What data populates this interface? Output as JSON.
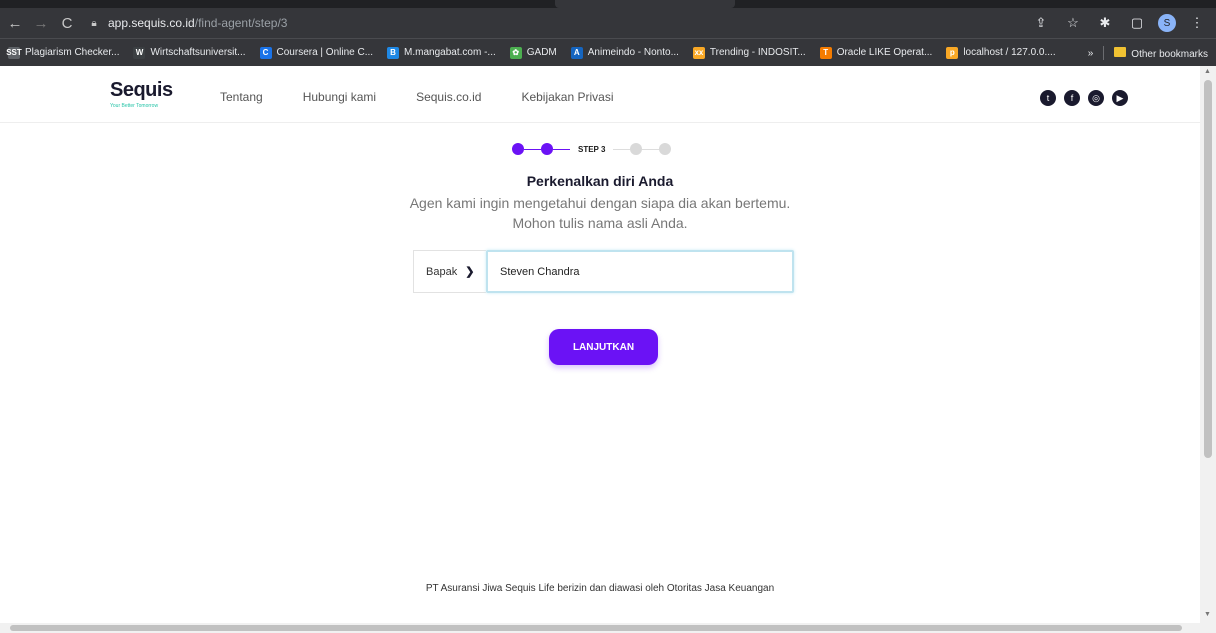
{
  "browser": {
    "url_host": "app.sequis.co.id",
    "url_path": "/find-agent/step/3",
    "profile_initial": "S",
    "bookmarks": [
      {
        "label": "Plagiarism Checker...",
        "icon": "checker-icon",
        "color": "#5f6368",
        "glyph": "SST"
      },
      {
        "label": "Wirtschaftsuniversit...",
        "icon": "w-icon",
        "color": "#3c4043",
        "glyph": "W"
      },
      {
        "label": "Coursera | Online C...",
        "icon": "coursera-icon",
        "color": "#1a73e8",
        "glyph": "C"
      },
      {
        "label": "M.mangabat.com -...",
        "icon": "mangabat-icon",
        "color": "#1e88e5",
        "glyph": "B"
      },
      {
        "label": "GADM",
        "icon": "gadm-icon",
        "color": "#4caf50",
        "glyph": "✿"
      },
      {
        "label": "Animeindo - Nonto...",
        "icon": "animeindo-icon",
        "color": "#1565c0",
        "glyph": "A"
      },
      {
        "label": "Trending - INDOSIT...",
        "icon": "indosit-icon",
        "color": "#f9a825",
        "glyph": "xx"
      },
      {
        "label": "Oracle LIKE Operat...",
        "icon": "oracle-icon",
        "color": "#f57c00",
        "glyph": "T"
      },
      {
        "label": "localhost / 127.0.0....",
        "icon": "phpmyadmin-icon",
        "color": "#f9a825",
        "glyph": "p"
      }
    ],
    "more_label": "»",
    "other_bookmarks": "Other bookmarks"
  },
  "header": {
    "brand": "Sequis",
    "tagline": "Your Better Tomorrow",
    "nav": [
      "Tentang",
      "Hubungi kami",
      "Sequis.co.id",
      "Kebijakan Privasi"
    ],
    "social": [
      "twitter-icon",
      "facebook-icon",
      "instagram-icon",
      "youtube-icon"
    ]
  },
  "stepper": {
    "current_label": "STEP 3",
    "completed": 2,
    "total": 5,
    "accent": "#6b12f5"
  },
  "main": {
    "headline": "Perkenalkan diri Anda",
    "subline1": "Agen kami ingin mengetahui dengan siapa dia akan bertemu.",
    "subline2": "Mohon tulis nama asli Anda."
  },
  "form": {
    "salutation": "Bapak",
    "name_value": "Steven Chandra",
    "submit_label": "LANJUTKAN"
  },
  "footer": {
    "text": "PT Asuransi Jiwa Sequis Life berizin dan diawasi oleh Otoritas Jasa Keuangan"
  }
}
